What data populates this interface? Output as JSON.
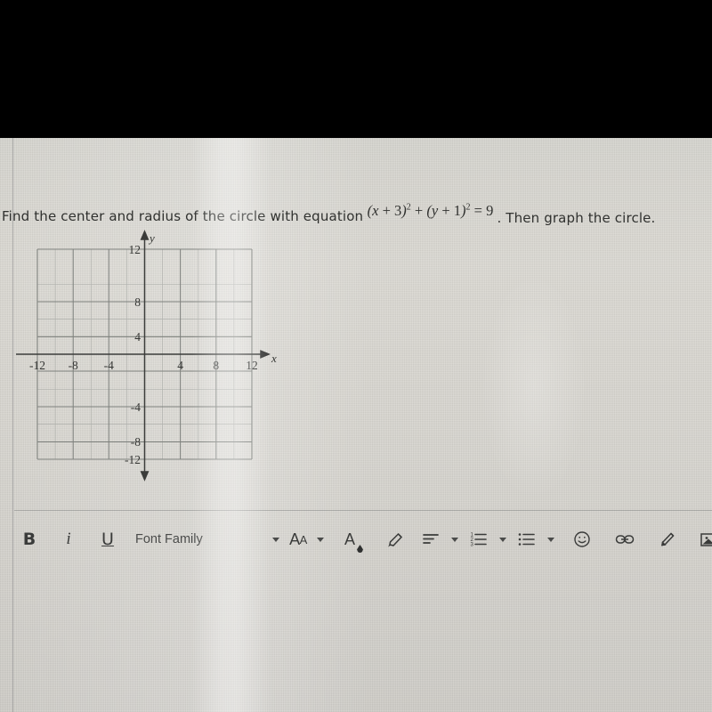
{
  "question": {
    "lead": "Find the center and radius of the circle with equation",
    "equation": {
      "full": "(x + 3)² + (y + 1)² = 9",
      "lhs_open": "(",
      "x_var": "x",
      "plus1": " + ",
      "a": "3",
      "close1": ")",
      "exp1": "2",
      "mid": " + ",
      "open2": "(",
      "y_var": "y",
      "plus2": " + ",
      "b": "1",
      "close2": ")",
      "exp2": "2",
      "equals": " = ",
      "rhs": "9"
    },
    "tail": ". Then graph the circle."
  },
  "graph": {
    "x_axis_label": "x",
    "y_axis_label": "y",
    "x_ticks": [
      "-12",
      "-8",
      "-4",
      "4",
      "8",
      "12"
    ],
    "y_ticks": [
      "12",
      "8",
      "4",
      "-4",
      "-8",
      "-12"
    ],
    "x_min": -14,
    "x_max": 14,
    "y_min": -14,
    "y_max": 14,
    "grid_min": -12,
    "grid_max": 12,
    "major_step": 4,
    "minor_step": 2,
    "grid_color": "#8d8f8c",
    "axis_color": "#3b3c3a"
  },
  "toolbar": {
    "bold_label": "B",
    "italic_label": "i",
    "underline_label": "U",
    "font_family_label": "Font Family",
    "font_size_label": "Aa",
    "font_size_label_main": "A",
    "font_size_label_small": "A",
    "text_color_label": "A",
    "icons": [
      "highlighter-icon",
      "align-icon",
      "numbered-list-icon",
      "bulleted-list-icon",
      "emoji-icon",
      "link-icon",
      "pencil-icon",
      "image-icon",
      "video-icon"
    ]
  },
  "colors": {
    "paper": "#dcdad4",
    "ink": "#30312f",
    "grid": "#8d8f8c",
    "band": "#000000"
  }
}
